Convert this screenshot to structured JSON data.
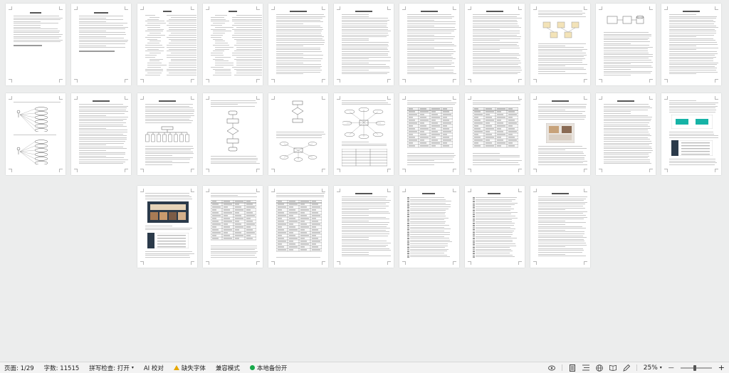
{
  "status_bar": {
    "page_label": "页面: 1/29",
    "word_count_label": "字数: 11515",
    "spell_check_label": "拼写检查: 打开",
    "ai_check_label": "AI 校对",
    "missing_font_label": "缺失字体",
    "compat_mode_label": "兼容模式",
    "local_backup_label": "本地备份开",
    "zoom_label": "25%",
    "zoom_minus": "—",
    "zoom_plus": "+"
  },
  "colors": {
    "warning": "#e6a700",
    "backup_ok": "#17a94a"
  }
}
